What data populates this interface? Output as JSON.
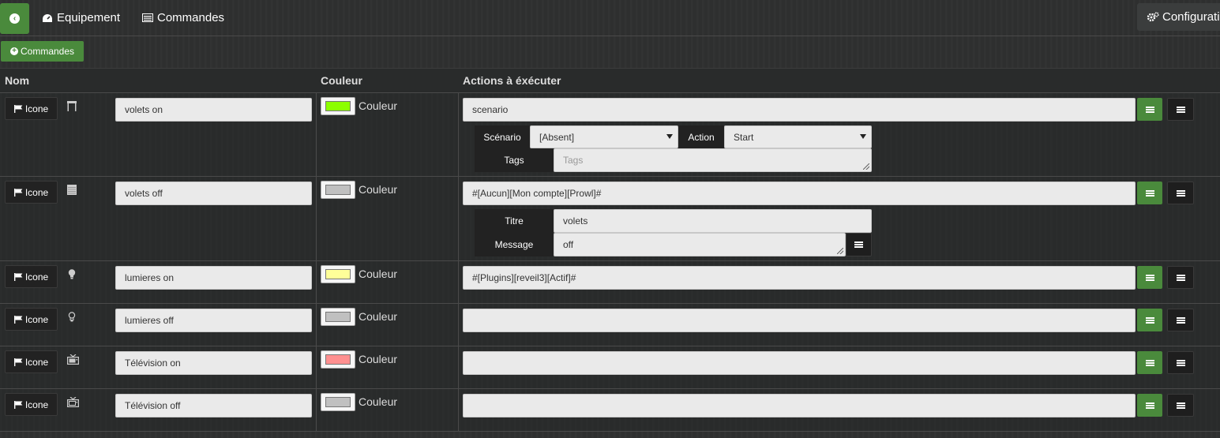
{
  "topbar": {
    "tabs": [
      {
        "label": "Equipement",
        "icon": "dashboard-icon"
      },
      {
        "label": "Commandes",
        "icon": "list-icon"
      }
    ],
    "config_label": "Configurati"
  },
  "add_button": {
    "label": "Commandes"
  },
  "table": {
    "headers": {
      "nom": "Nom",
      "couleur": "Couleur",
      "actions": "Actions à éxécuter"
    },
    "icone_label": "Icone",
    "couleur_label": "Couleur",
    "rows": [
      {
        "name": "volets on",
        "icon": "shutter-open-icon",
        "color": "#8cff00",
        "action": "scenario",
        "scenario_label": "Scénario",
        "scenario_value": "[Absent]",
        "action_label": "Action",
        "action_value": "Start",
        "tags_label": "Tags",
        "tags_placeholder": "Tags"
      },
      {
        "name": "volets off",
        "icon": "shutter-closed-icon",
        "color": "#c0c0c0",
        "action": "#[Aucun][Mon compte][Prowl]#",
        "titre_label": "Titre",
        "titre_value": "volets",
        "message_label": "Message",
        "message_value": "off"
      },
      {
        "name": "lumieres on",
        "icon": "lightbulb-on-icon",
        "color": "#ffff99",
        "action": "#[Plugins][reveil3][Actif]#"
      },
      {
        "name": "lumieres off",
        "icon": "lightbulb-off-icon",
        "color": "#c0c0c0",
        "action": ""
      },
      {
        "name": "Télévision on",
        "icon": "tv-on-icon",
        "color": "#ff9090",
        "action": ""
      },
      {
        "name": "Télévision off",
        "icon": "tv-off-icon",
        "color": "#c0c0c0",
        "action": ""
      }
    ]
  }
}
